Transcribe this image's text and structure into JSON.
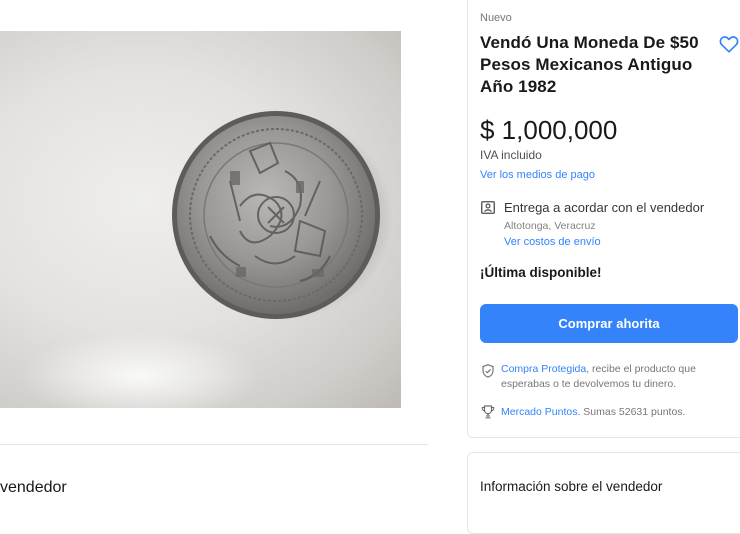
{
  "product": {
    "condition": "Nuevo",
    "title": "Vendó Una Moneda De $50 Pesos Mexicanos Antiguo Año 1982",
    "price": "$ 1,000,000",
    "tax_note": "IVA incluido",
    "payment_link": "Ver los medios de pago"
  },
  "shipping": {
    "title": "Entrega a acordar con el vendedor",
    "location": "Altotonga, Veracruz",
    "costs_link": "Ver costos de envío"
  },
  "stock_label": "¡Última disponible!",
  "buy_button_label": "Comprar ahorita",
  "protection": {
    "link": "Compra Protegida",
    "text": ", recibe el producto que esperabas o te devolvemos tu dinero."
  },
  "points": {
    "link": "Mercado Puntos",
    "text": ". Sumas 52631 puntos."
  },
  "left_section_heading": "vendedor",
  "seller_info_title": "Información sobre el vendedor",
  "icons": {
    "favorite": "heart-outline-icon",
    "shipping": "person-card-icon",
    "protection": "shield-check-icon",
    "points": "trophy-icon"
  },
  "colors": {
    "accent": "#3483fa",
    "background": "#ffffff"
  }
}
